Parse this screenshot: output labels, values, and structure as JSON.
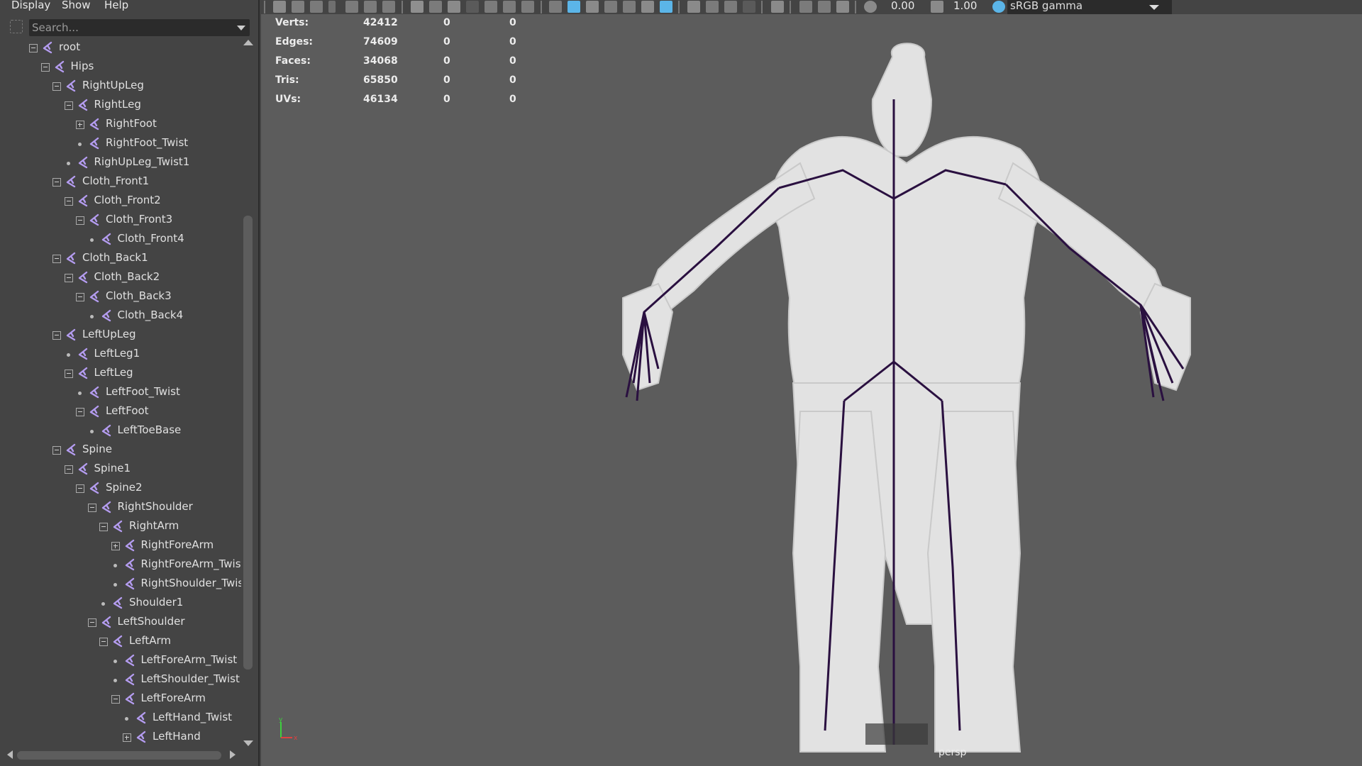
{
  "menubar": {
    "items": [
      "Display",
      "Show",
      "Help"
    ]
  },
  "search": {
    "placeholder": "Search..."
  },
  "outliner": {
    "nodes": [
      {
        "label": "root",
        "depth": 0,
        "expander": "minus"
      },
      {
        "label": "Hips",
        "depth": 1,
        "expander": "minus"
      },
      {
        "label": "RightUpLeg",
        "depth": 2,
        "expander": "minus"
      },
      {
        "label": "RightLeg",
        "depth": 3,
        "expander": "minus"
      },
      {
        "label": "RightFoot",
        "depth": 4,
        "expander": "plus"
      },
      {
        "label": "RightFoot_Twist",
        "depth": 4,
        "expander": "leaf"
      },
      {
        "label": "RighUpLeg_Twist1",
        "depth": 3,
        "expander": "leaf"
      },
      {
        "label": "Cloth_Front1",
        "depth": 2,
        "expander": "minus"
      },
      {
        "label": "Cloth_Front2",
        "depth": 3,
        "expander": "minus"
      },
      {
        "label": "Cloth_Front3",
        "depth": 4,
        "expander": "minus"
      },
      {
        "label": "Cloth_Front4",
        "depth": 5,
        "expander": "leaf"
      },
      {
        "label": "Cloth_Back1",
        "depth": 2,
        "expander": "minus"
      },
      {
        "label": "Cloth_Back2",
        "depth": 3,
        "expander": "minus"
      },
      {
        "label": "Cloth_Back3",
        "depth": 4,
        "expander": "minus"
      },
      {
        "label": "Cloth_Back4",
        "depth": 5,
        "expander": "leaf"
      },
      {
        "label": "LeftUpLeg",
        "depth": 2,
        "expander": "minus"
      },
      {
        "label": "LeftLeg1",
        "depth": 3,
        "expander": "leaf"
      },
      {
        "label": "LeftLeg",
        "depth": 3,
        "expander": "minus"
      },
      {
        "label": "LeftFoot_Twist",
        "depth": 4,
        "expander": "leaf"
      },
      {
        "label": "LeftFoot",
        "depth": 4,
        "expander": "minus"
      },
      {
        "label": "LeftToeBase",
        "depth": 5,
        "expander": "leaf"
      },
      {
        "label": "Spine",
        "depth": 2,
        "expander": "minus"
      },
      {
        "label": "Spine1",
        "depth": 3,
        "expander": "minus"
      },
      {
        "label": "Spine2",
        "depth": 4,
        "expander": "minus"
      },
      {
        "label": "RightShoulder",
        "depth": 5,
        "expander": "minus"
      },
      {
        "label": "RightArm",
        "depth": 6,
        "expander": "minus"
      },
      {
        "label": "RightForeArm",
        "depth": 7,
        "expander": "plus"
      },
      {
        "label": "RightForeArm_Twist",
        "depth": 7,
        "expander": "leaf"
      },
      {
        "label": "RightShoulder_Twist",
        "depth": 7,
        "expander": "leaf"
      },
      {
        "label": "Shoulder1",
        "depth": 6,
        "expander": "leaf"
      },
      {
        "label": "LeftShoulder",
        "depth": 5,
        "expander": "minus"
      },
      {
        "label": "LeftArm",
        "depth": 6,
        "expander": "minus"
      },
      {
        "label": "LeftForeArm_Twist",
        "depth": 7,
        "expander": "leaf"
      },
      {
        "label": "LeftShoulder_Twist",
        "depth": 7,
        "expander": "leaf"
      },
      {
        "label": "LeftForeArm",
        "depth": 7,
        "expander": "minus"
      },
      {
        "label": "LeftHand_Twist",
        "depth": 8,
        "expander": "leaf"
      },
      {
        "label": "LeftHand",
        "depth": 8,
        "expander": "plus"
      }
    ]
  },
  "toolbar": {
    "exposure": "0.00",
    "gamma": "1.00",
    "colorspace": "sRGB gamma"
  },
  "hud": {
    "rows": [
      {
        "label": "Verts:",
        "v1": "42412",
        "v2": "0",
        "v3": "0"
      },
      {
        "label": "Edges:",
        "v1": "74609",
        "v2": "0",
        "v3": "0"
      },
      {
        "label": "Faces:",
        "v1": "34068",
        "v2": "0",
        "v3": "0"
      },
      {
        "label": "Tris:",
        "v1": "65850",
        "v2": "0",
        "v3": "0"
      },
      {
        "label": "UVs:",
        "v1": "46134",
        "v2": "0",
        "v3": "0"
      }
    ]
  },
  "viewport": {
    "camera": "persp",
    "axis_labels": {
      "x": "x",
      "y": "y"
    }
  },
  "colors": {
    "panel_bg": "#444444",
    "viewport_bg": "#5c5c5c",
    "joint_icon": "#b49cf0",
    "skeleton": "#2a1040",
    "mesh": "#e0e0e0"
  }
}
